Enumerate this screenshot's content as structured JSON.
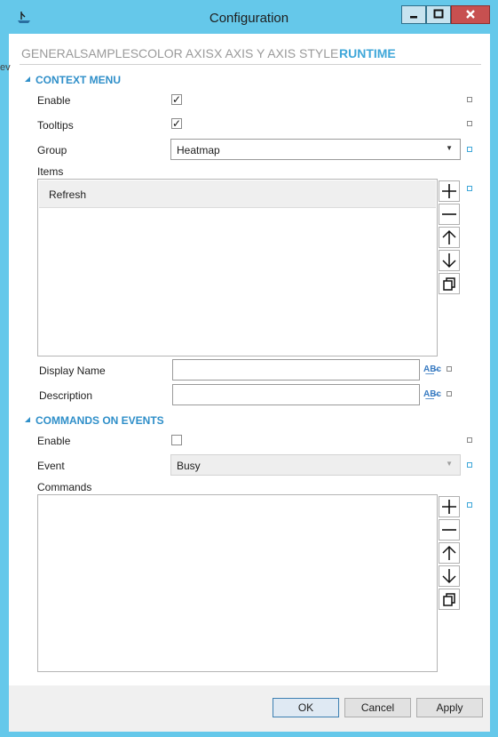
{
  "window": {
    "title": "Configuration",
    "edge_fragment": "ev"
  },
  "tabs": [
    {
      "label": "GENERAL"
    },
    {
      "label": "SAMPLES"
    },
    {
      "label": "COLOR AXIS"
    },
    {
      "label": "X AXIS"
    },
    {
      "label": "Y AXIS"
    },
    {
      "label": "STYLE"
    },
    {
      "label": "RUNTIME",
      "active": true
    }
  ],
  "context_menu": {
    "title": "CONTEXT MENU",
    "enable_label": "Enable",
    "enable_checked": true,
    "tooltips_label": "Tooltips",
    "tooltips_checked": true,
    "group_label": "Group",
    "group_value": "Heatmap",
    "items_label": "Items",
    "items": [
      "Refresh"
    ],
    "display_name_label": "Display Name",
    "display_name_value": "",
    "description_label": "Description",
    "description_value": ""
  },
  "commands_on_events": {
    "title": "COMMANDS ON EVENTS",
    "enable_label": "Enable",
    "enable_checked": false,
    "event_label": "Event",
    "event_value": "Busy",
    "commands_label": "Commands",
    "commands": []
  },
  "glyphs": {
    "check": "✓",
    "dropdown": "▼",
    "abc": "A͟B̶c"
  },
  "buttons": {
    "ok": "OK",
    "cancel": "Cancel",
    "apply": "Apply"
  },
  "colors": {
    "accent": "#3fa7d9",
    "frame": "#65c8ea",
    "close": "#c75050"
  }
}
